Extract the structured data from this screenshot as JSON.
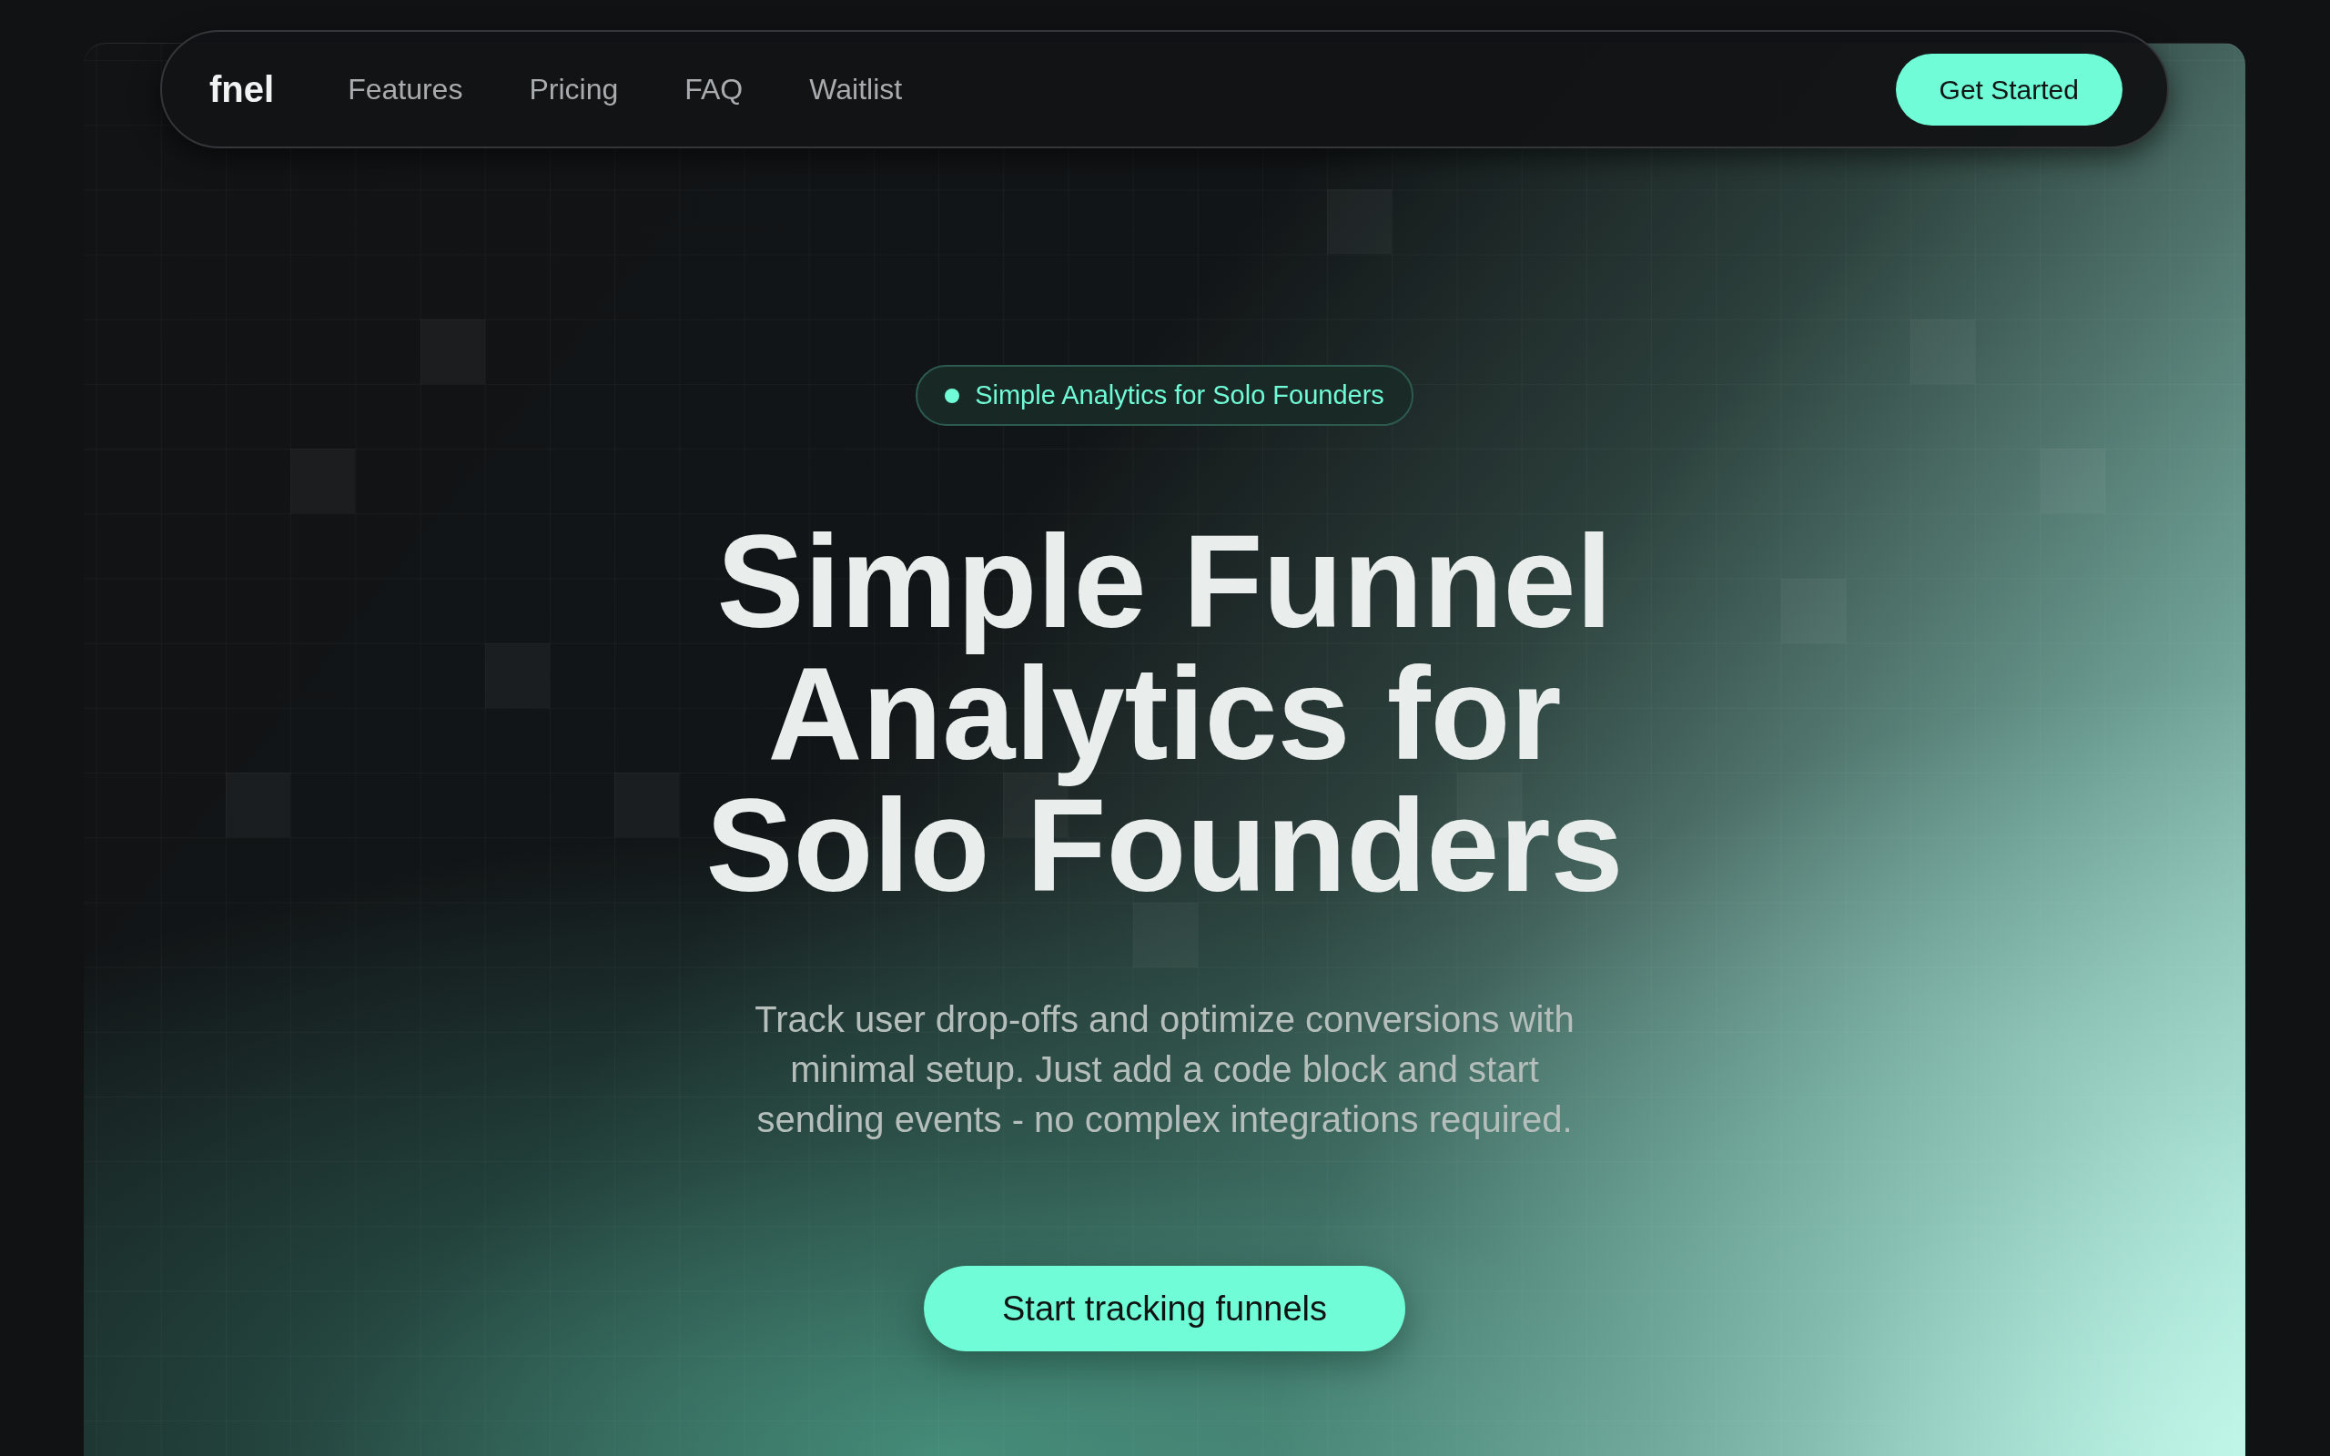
{
  "navbar": {
    "logo": "fnel",
    "links": [
      "Features",
      "Pricing",
      "FAQ",
      "Waitlist"
    ],
    "cta": "Get Started"
  },
  "hero": {
    "badge": "Simple Analytics for Solo Founders",
    "title": "Simple Funnel Analytics for Solo Founders",
    "description": "Track user drop-offs and optimize conversions with minimal setup. Just add a code block and start sending events - no complex integrations required.",
    "cta": "Start tracking funnels"
  }
}
